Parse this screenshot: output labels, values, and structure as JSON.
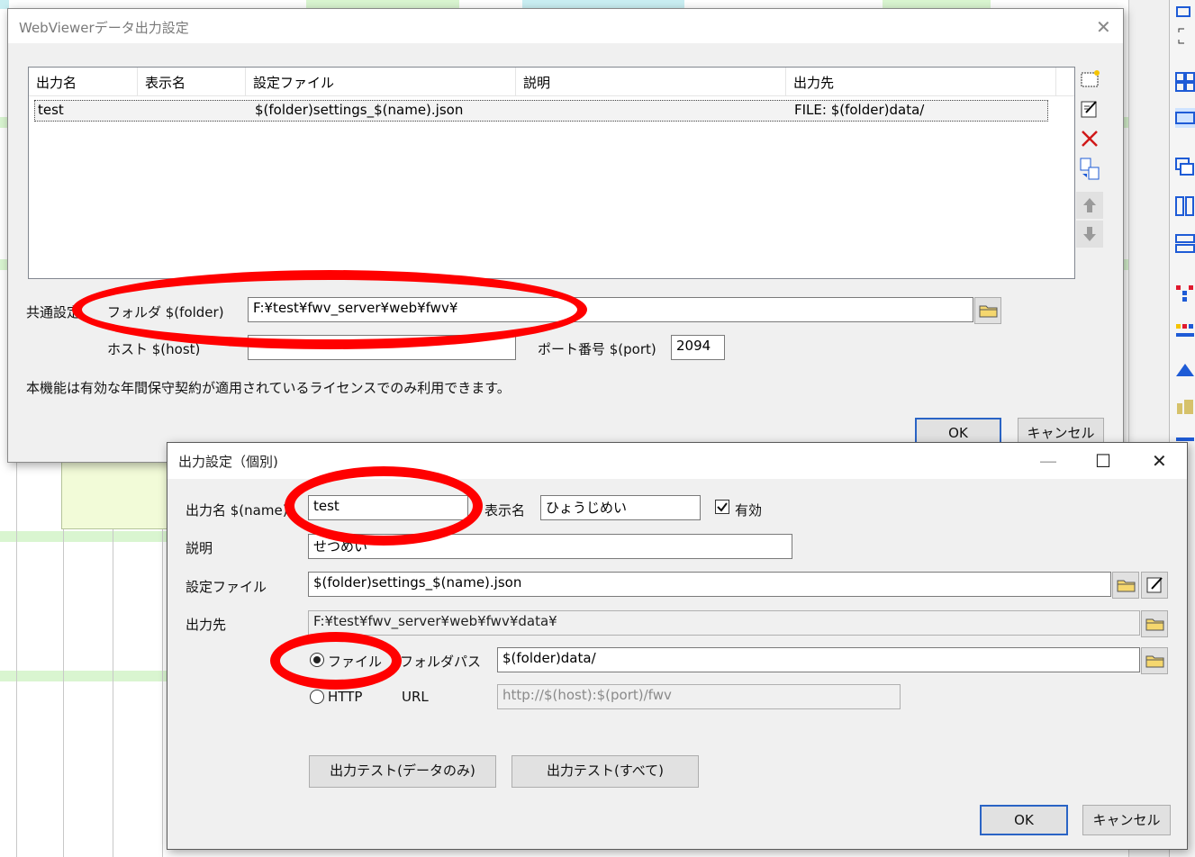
{
  "main_dialog": {
    "title": "WebViewerデータ出力設定",
    "close_glyph": "✕",
    "list": {
      "columns": [
        "出力名",
        "表示名",
        "設定ファイル",
        "説明",
        "出力先"
      ],
      "rows": [
        {
          "name": "test",
          "display": "",
          "settings": "$(folder)settings_$(name).json",
          "description": "",
          "output": "FILE: $(folder)data/"
        }
      ]
    },
    "common_label": "共通設定",
    "folder_label": "フォルダ $(folder)",
    "folder_value": "F:¥test¥fwv_server¥web¥fwv¥",
    "host_label": "ホスト $(host)",
    "host_value": "",
    "port_label": "ポート番号 $(port)",
    "port_value": "2094",
    "notice": "本機能は有効な年間保守契約が適用されているライセンスでのみ利用できます。",
    "ok_label": "OK",
    "cancel_label": "キャンセル"
  },
  "sub_dialog": {
    "title": "出力設定（個別)",
    "minimize_glyph": "—",
    "maximize_glyph": "☐",
    "close_glyph": "✕",
    "name_label": "出力名 $(name)",
    "name_value": "test",
    "display_label": "表示名",
    "display_value": "ひょうじめい",
    "enabled_label": "有効",
    "enabled": true,
    "desc_label": "説明",
    "desc_value": "せつめい",
    "settings_label": "設定ファイル",
    "settings_value": "$(folder)settings_$(name).json",
    "output_label": "出力先",
    "output_value": "F:¥test¥fwv_server¥web¥fwv¥data¥",
    "radio_file_label": "ファイル",
    "folder_path_label": "フォルダパス",
    "folder_path_value": "$(folder)data/",
    "radio_http_label": "HTTP",
    "url_label": "URL",
    "url_value": "http://$(host):$(port)/fwv",
    "test_data_label": "出力テスト(データのみ)",
    "test_all_label": "出力テスト(すべて)",
    "ok_label": "OK",
    "cancel_label": "キャンセル"
  },
  "colors": {
    "annotation": "#ff0000",
    "default_button_border": "#2a64c5",
    "toolbar_blue": "#1e5bd6"
  }
}
